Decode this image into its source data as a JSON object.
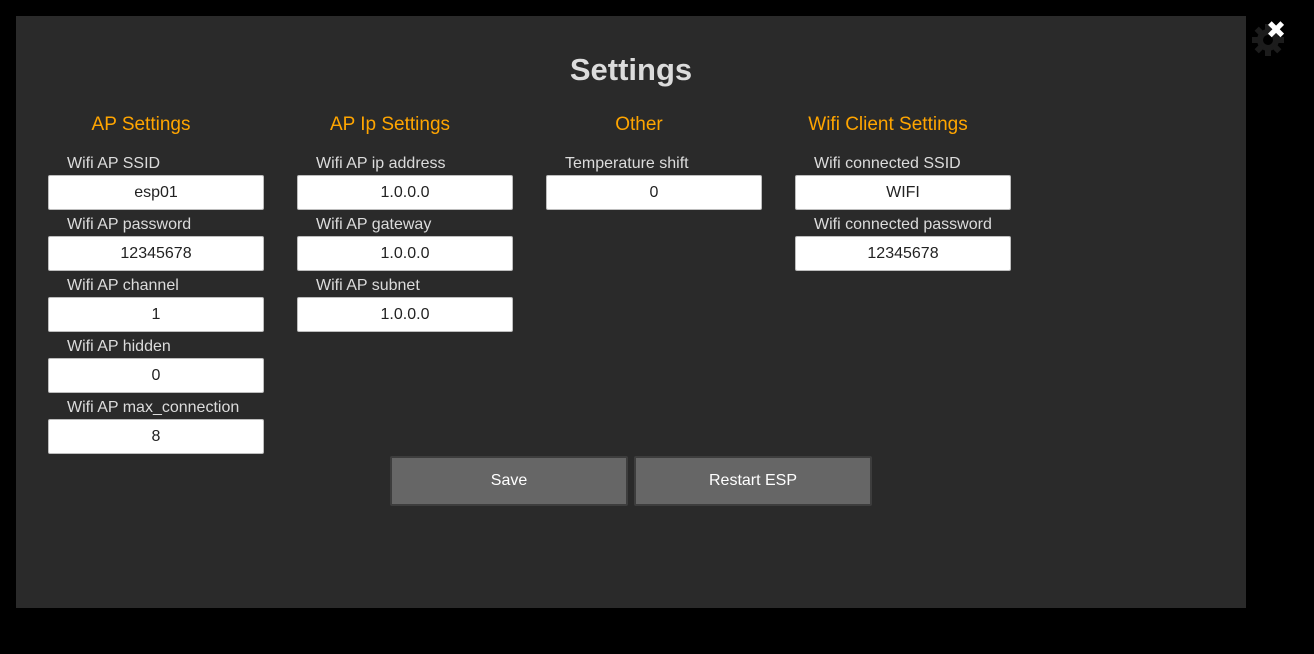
{
  "icons": {
    "gear": "gear-icon",
    "close": "close-icon",
    "close_glyph": "✖"
  },
  "colors": {
    "background": "#000000",
    "panel": "#2a2a2a",
    "heading_accent": "#ffa500",
    "text": "#dcdcdc",
    "button": "#666666"
  },
  "title": "Settings",
  "columns": [
    {
      "heading": "AP Settings",
      "fields": [
        {
          "label": "Wifi AP SSID",
          "value": "esp01"
        },
        {
          "label": "Wifi AP password",
          "value": "12345678"
        },
        {
          "label": "Wifi AP channel",
          "value": "1"
        },
        {
          "label": "Wifi AP hidden",
          "value": "0"
        },
        {
          "label": "Wifi AP max_connection",
          "value": "8"
        }
      ]
    },
    {
      "heading": "AP Ip Settings",
      "fields": [
        {
          "label": "Wifi AP ip address",
          "value": "1.0.0.0"
        },
        {
          "label": "Wifi AP gateway",
          "value": "1.0.0.0"
        },
        {
          "label": "Wifi AP subnet",
          "value": "1.0.0.0"
        }
      ]
    },
    {
      "heading": "Other",
      "fields": [
        {
          "label": "Temperature shift",
          "value": "0"
        }
      ]
    },
    {
      "heading": "Wifi Client Settings",
      "fields": [
        {
          "label": "Wifi connected SSID",
          "value": "WIFI"
        },
        {
          "label": "Wifi connected password",
          "value": "12345678"
        }
      ]
    }
  ],
  "buttons": {
    "save": "Save",
    "restart": "Restart ESP"
  }
}
